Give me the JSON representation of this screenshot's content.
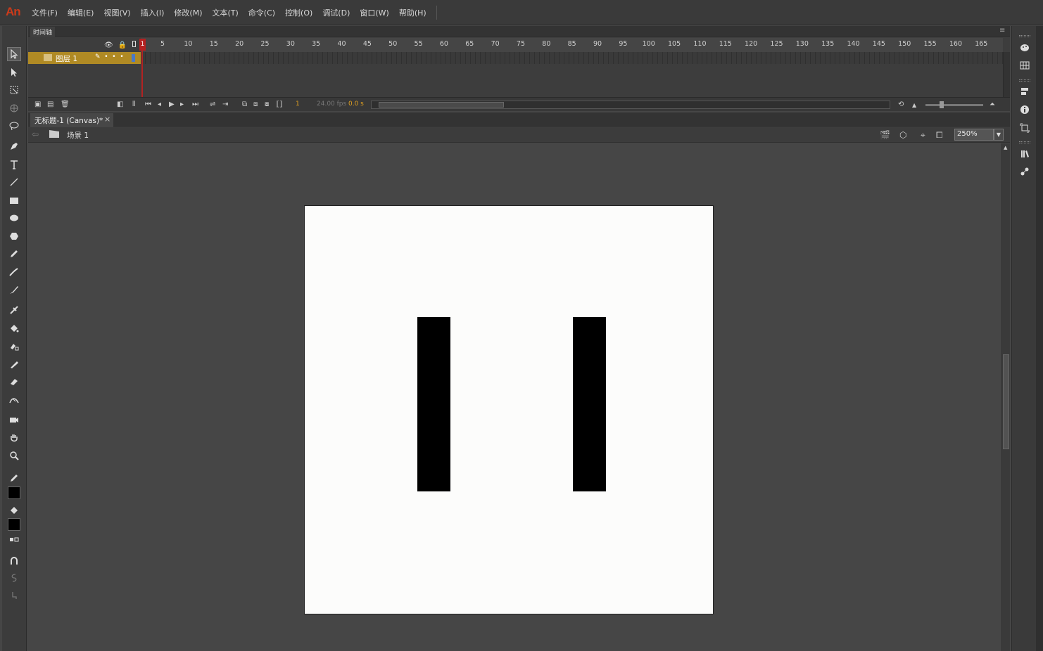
{
  "app": {
    "logo": "An"
  },
  "menu": [
    "文件(F)",
    "编辑(E)",
    "视图(V)",
    "插入(I)",
    "修改(M)",
    "文本(T)",
    "命令(C)",
    "控制(O)",
    "调试(D)",
    "窗口(W)",
    "帮助(H)"
  ],
  "timeline": {
    "tab_label": "时间轴",
    "layer_name": "图层 1",
    "ruler_numbers": [
      "1",
      "5",
      "10",
      "15",
      "20",
      "25",
      "30",
      "35",
      "40",
      "45",
      "50",
      "55",
      "60",
      "65",
      "70",
      "75",
      "80",
      "85",
      "90",
      "95",
      "100",
      "105",
      "110",
      "115",
      "120",
      "125",
      "130",
      "135",
      "140",
      "145",
      "150",
      "155",
      "160",
      "165"
    ],
    "current_frame": "1",
    "fps": "24.00 fps",
    "time": "0.0 s"
  },
  "document": {
    "tab_label": "无标题-1 (Canvas)*",
    "close_glyph": "×",
    "scene_label": "场景 1",
    "zoom": "250%"
  },
  "colors": {
    "stroke": "#000000",
    "fill": "#000000",
    "layer_highlight": "#b08a24",
    "playhead": "#b22222",
    "logo": "#cc3a1a"
  }
}
